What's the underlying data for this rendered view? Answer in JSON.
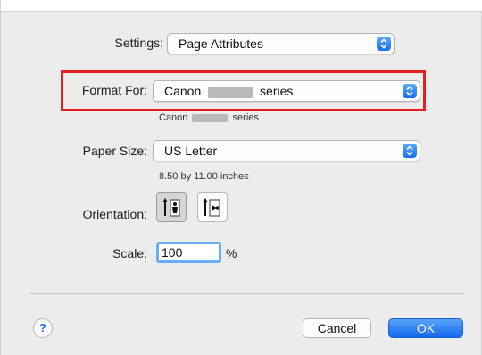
{
  "settings": {
    "label": "Settings:",
    "value": "Page Attributes"
  },
  "format_for": {
    "label": "Format For:",
    "value_prefix": "Canon",
    "value_suffix": "series",
    "sub_prefix": "Canon",
    "sub_suffix": "series"
  },
  "paper_size": {
    "label": "Paper Size:",
    "value": "US Letter",
    "dimensions": "8.50 by 11.00 inches"
  },
  "orientation": {
    "label": "Orientation:",
    "options": [
      {
        "name": "portrait",
        "selected": true
      },
      {
        "name": "landscape",
        "selected": false
      }
    ]
  },
  "scale": {
    "label": "Scale:",
    "value": "100",
    "unit": "%"
  },
  "buttons": {
    "help": "?",
    "cancel": "Cancel",
    "ok": "OK"
  },
  "colors": {
    "accent": "#1a6ef0",
    "highlight_border": "#e4201c",
    "dialog_bg": "#ececec"
  }
}
